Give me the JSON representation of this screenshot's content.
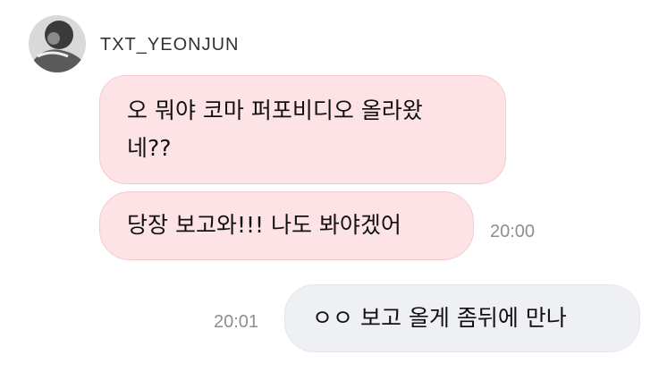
{
  "chat": {
    "sender_name": "TXT_YEONJUN",
    "avatar_icon": "profile-avatar-icon",
    "colors": {
      "incoming_bubble": "#fde3e6",
      "outgoing_bubble": "#eef0f4",
      "timestamp": "#8e8e93"
    },
    "messages": [
      {
        "direction": "incoming",
        "text": "오 뭐야 코마 퍼포비디오 올라왔\n네??",
        "time": ""
      },
      {
        "direction": "incoming",
        "text": "당장 보고와!!! 나도 봐야겠어",
        "time": "20:00"
      },
      {
        "direction": "outgoing",
        "text": "ㅇㅇ 보고 올게 좀뒤에 만나",
        "time": "20:01"
      }
    ]
  }
}
